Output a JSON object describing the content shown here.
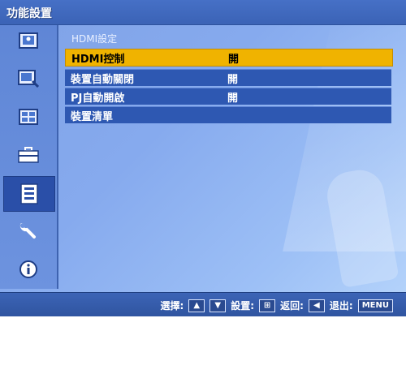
{
  "window": {
    "title": "功能設置"
  },
  "sidebar": {
    "items": [
      {
        "icon": "picture-icon"
      },
      {
        "icon": "picture-adjust-icon"
      },
      {
        "icon": "position-icon"
      },
      {
        "icon": "toolbox-icon"
      },
      {
        "icon": "list-icon",
        "active": true
      },
      {
        "icon": "wrench-icon"
      },
      {
        "icon": "info-icon"
      }
    ]
  },
  "main": {
    "section_title": "HDMI設定",
    "rows": [
      {
        "label": "HDMI控制",
        "value": "開",
        "selected": true
      },
      {
        "label": "裝置自動關閉",
        "value": "開"
      },
      {
        "label": "PJ自動開啟",
        "value": "開"
      },
      {
        "label": "裝置清單",
        "value": ""
      }
    ]
  },
  "footer": {
    "select_label": "選擇:",
    "set_label": "設置:",
    "back_label": "返回:",
    "exit_label": "退出:",
    "menu_key": "MENU"
  },
  "colors": {
    "selected_row": "#f0b300",
    "row_bg": "#2e58b2",
    "title_bar": "#4670c6"
  }
}
